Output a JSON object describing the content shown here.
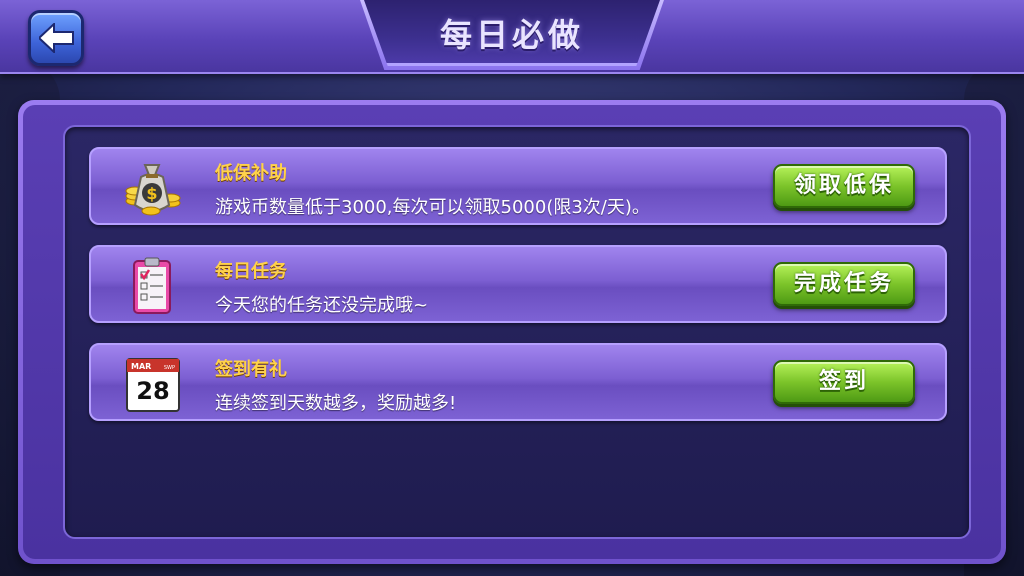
{
  "header": {
    "title": "每日必做",
    "back_icon": "back-arrow-icon"
  },
  "tasks": [
    {
      "icon": "money-bag-icon",
      "title": "低保补助",
      "description": "游戏币数量低于3000,每次可以领取5000(限3次/天)。",
      "button_label": "领取低保"
    },
    {
      "icon": "clipboard-checklist-icon",
      "title": "每日任务",
      "description": "今天您的任务还没完成哦~",
      "button_label": "完成任务"
    },
    {
      "icon": "calendar-icon",
      "title": "签到有礼",
      "description": "连续签到天数越多，奖励越多!",
      "button_label": "签到",
      "calendar": {
        "month": "MAR",
        "day": "28",
        "weekday": "SWP"
      }
    }
  ],
  "colors": {
    "title_text": "#ffd24a",
    "button_green": "#7cc42a",
    "panel_purple": "#6f52cc",
    "back_button_blue": "#3d63d8"
  }
}
